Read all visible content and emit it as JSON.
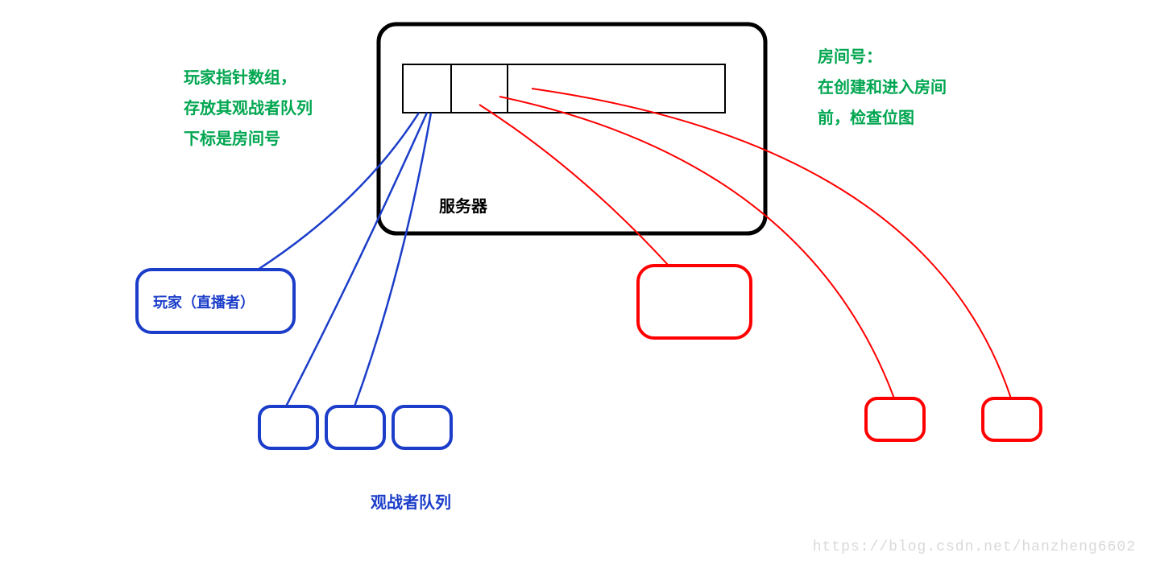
{
  "annotations": {
    "left": {
      "line1": "玩家指针数组，",
      "line2": "存放其观战者队列",
      "line3": "下标是房间号"
    },
    "right": {
      "line1": "房间号：",
      "line2": "在创建和进入房间",
      "line3": "前，检查位图"
    }
  },
  "server_label": "服务器",
  "player_label": "玩家（直播者）",
  "queue_label": "观战者队列",
  "watermark": "https://blog.csdn.net/hanzheng6602"
}
